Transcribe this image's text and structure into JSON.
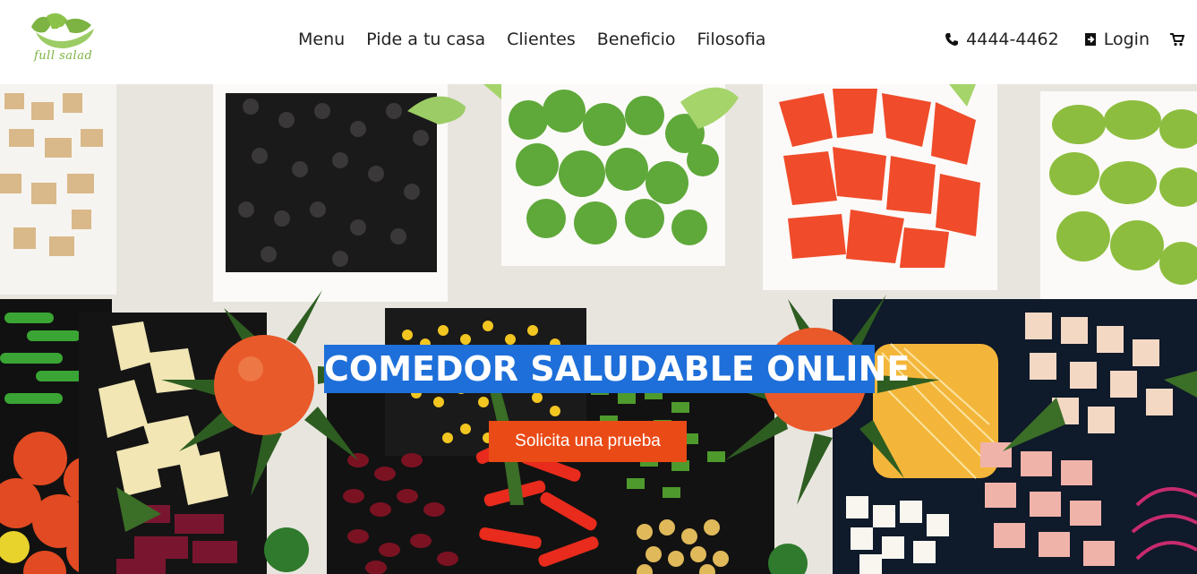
{
  "brand": {
    "logo_text": "full salad"
  },
  "nav": {
    "items": [
      {
        "label": "Menu"
      },
      {
        "label": "Pide a tu casa"
      },
      {
        "label": "Clientes"
      },
      {
        "label": "Beneficio"
      },
      {
        "label": "Filosofia"
      }
    ]
  },
  "header": {
    "phone": "4444-4462",
    "login": "Login",
    "icons": [
      "phone-icon",
      "login-icon",
      "cart-icon"
    ]
  },
  "hero": {
    "headline": "COMEDOR SALUDABLE ONLINE",
    "cta": "Solicita una prueba",
    "colors": {
      "headline_bg": "#1e6fd9",
      "cta_bg": "#ea4a16",
      "logo_green": "#7cb342"
    }
  }
}
